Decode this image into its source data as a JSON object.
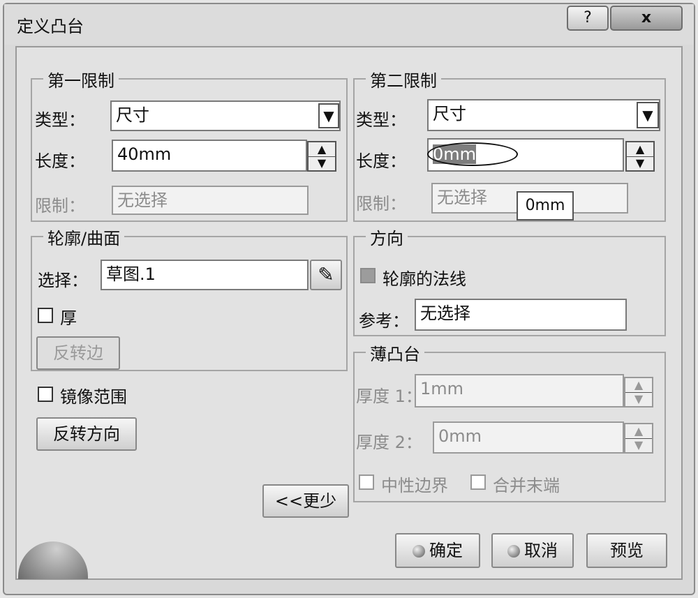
{
  "window": {
    "title": "定义凸台",
    "help_label": "?",
    "close_label": "x"
  },
  "first_limit": {
    "legend": "第一限制",
    "type_label": "类型：",
    "type_value": "尺寸",
    "length_label": "长度：",
    "length_value": "40mm",
    "limit_label": "限制：",
    "limit_value": "无选择"
  },
  "second_limit": {
    "legend": "第二限制",
    "type_label": "类型：",
    "type_value": "尺寸",
    "length_label": "长度：",
    "length_value": "0mm",
    "limit_label": "限制：",
    "limit_value": "无选择",
    "tooltip": "0mm"
  },
  "profile": {
    "legend": "轮廓/曲面",
    "select_label": "选择：",
    "select_value": "草图.1",
    "thick_label": "厚",
    "thick_checked": false,
    "reverse_side_label": "反转边"
  },
  "mirror_label": "镜像范围",
  "mirror_checked": false,
  "reverse_direction_label": "反转方向",
  "less_label": "<<更少",
  "direction": {
    "legend": "方向",
    "normal_label": "轮廓的法线",
    "normal_checked": true,
    "ref_label": "参考：",
    "ref_value": "无选择"
  },
  "thin": {
    "legend": "薄凸台",
    "thickness1_label": "厚度 1：",
    "thickness1_value": "1mm",
    "thickness2_label": "厚度 2：",
    "thickness2_value": "0mm",
    "neutral_label": "中性边界",
    "merge_label": "合并末端"
  },
  "actions": {
    "ok": "确定",
    "cancel": "取消",
    "preview": "预览"
  },
  "icons": {
    "dropdown": "▼",
    "spin_up": "▲",
    "spin_down": "▼",
    "sketch": "✎"
  }
}
